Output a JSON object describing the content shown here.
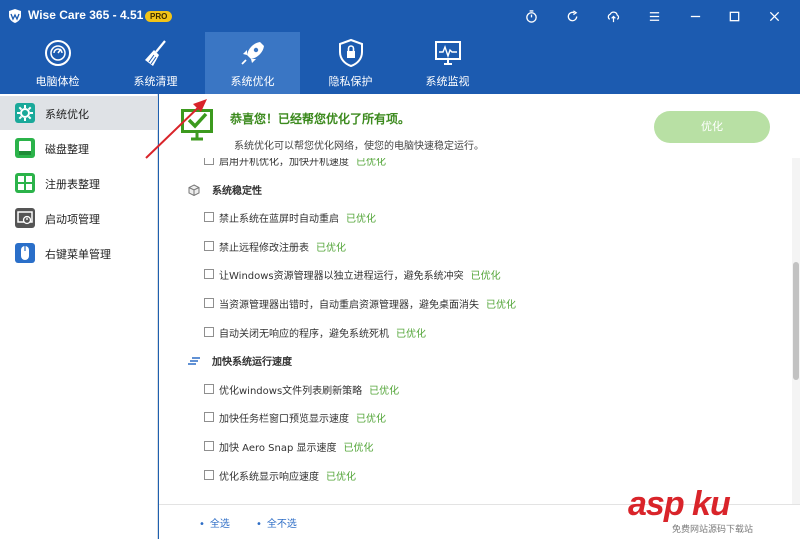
{
  "window": {
    "title": "Wise Care 365 - 4.51",
    "badge": "PRO",
    "buttons": [
      "timer-icon",
      "refresh-icon",
      "cloud-sync-icon",
      "menu-icon",
      "minimize-icon",
      "maximize-icon",
      "close-icon"
    ]
  },
  "nav": {
    "tabs": [
      {
        "label": "电脑体检",
        "icon": "checkup-icon"
      },
      {
        "label": "系统清理",
        "icon": "broom-icon"
      },
      {
        "label": "系统优化",
        "icon": "rocket-icon"
      },
      {
        "label": "隐私保护",
        "icon": "shield-icon"
      },
      {
        "label": "系统监视",
        "icon": "monitor-icon"
      }
    ],
    "active": "系统优化"
  },
  "sidebar": {
    "items": [
      {
        "label": "系统优化",
        "icon": "gear-icon",
        "color": "#1aa99a"
      },
      {
        "label": "磁盘整理",
        "icon": "disk-icon",
        "color": "#2bb34a"
      },
      {
        "label": "注册表整理",
        "icon": "registry-icon",
        "color": "#2bb34a"
      },
      {
        "label": "启动项管理",
        "icon": "startup-icon",
        "color": "#555555"
      },
      {
        "label": "右键菜单管理",
        "icon": "mouse-icon",
        "color": "#2a6fc9"
      }
    ]
  },
  "banner": {
    "title": "恭喜您！已经帮您优化了所有项。",
    "subtitle": "系统优化可以帮您优化网络，使您的电脑快速稳定运行。",
    "button": "优化"
  },
  "list": {
    "status_label": "已优化",
    "items": [
      {
        "type": "row",
        "text": "启用开机优化，加快开机速度"
      },
      {
        "type": "group",
        "text": "系统稳定性",
        "icon": "cube-icon"
      },
      {
        "type": "row",
        "text": "禁止系统在蓝屏时自动重启"
      },
      {
        "type": "row",
        "text": "禁止远程修改注册表"
      },
      {
        "type": "row",
        "text": "让Windows资源管理器以独立进程运行，避免系统冲突"
      },
      {
        "type": "row",
        "text": "当资源管理器出错时，自动重启资源管理器，避免桌面消失"
      },
      {
        "type": "row",
        "text": "自动关闭无响应的程序，避免系统死机"
      },
      {
        "type": "group",
        "text": "加快系统运行速度",
        "icon": "speed-icon"
      },
      {
        "type": "row",
        "text": "优化windows文件列表刷新策略"
      },
      {
        "type": "row",
        "text": "加快任务栏窗口预览显示速度"
      },
      {
        "type": "row",
        "text": "加快 Aero Snap 显示速度"
      },
      {
        "type": "row",
        "text": "优化系统显示响应速度"
      }
    ]
  },
  "footer": {
    "select_all": "全选",
    "select_none": "全不选"
  },
  "watermark": {
    "text": "asp ku",
    "sub": "免费网站源码下载站"
  },
  "colors": {
    "header": "#1c5bb0",
    "active_tab": "#3a76c4",
    "status": "#54a63a",
    "title_green": "#3c8a1e",
    "button_green": "#b8e0a4"
  }
}
